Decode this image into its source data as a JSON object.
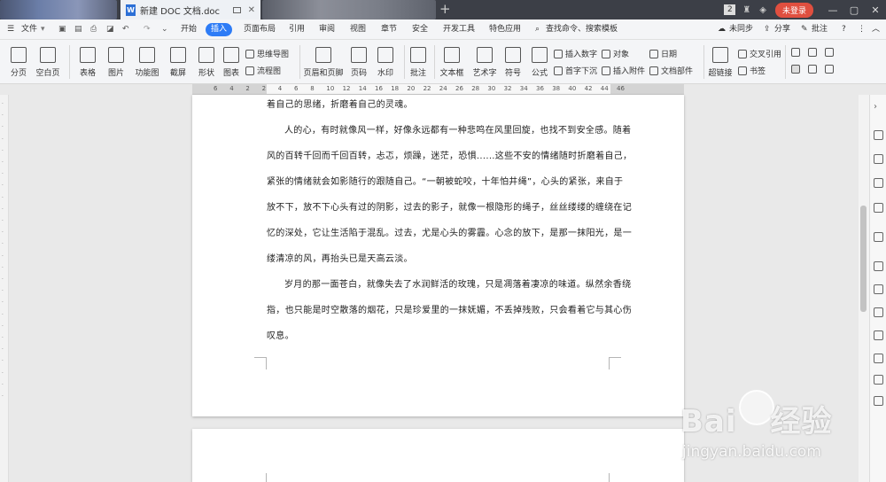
{
  "titlebar": {
    "tab_title": "新建 DOC 文档.doc",
    "badge_count": "2",
    "login_label": "未登录"
  },
  "menubar": {
    "file": "文件",
    "tabs": [
      "开始",
      "插入",
      "页面布局",
      "引用",
      "审阅",
      "视图",
      "章节",
      "安全",
      "开发工具",
      "特色应用"
    ],
    "search": "查找命令、搜索模板",
    "sync": "未同步",
    "share": "分享",
    "comment": "批注"
  },
  "ribbon": {
    "big": [
      "分页",
      "空白页",
      "表格",
      "图片",
      "功能图",
      "截屏",
      "形状",
      "图表",
      "页眉和页脚",
      "页码",
      "水印",
      "批注",
      "文本框",
      "艺术字",
      "符号",
      "公式",
      "超链接"
    ],
    "small": [
      "思维导图",
      "流程图",
      "插入数字",
      "对象",
      "日期",
      "首字下沉",
      "插入附件",
      "文档部件",
      "交叉引用",
      "书签"
    ]
  },
  "ruler": {
    "numbers": [
      "6",
      "4",
      "2",
      "2",
      "4",
      "6",
      "8",
      "10",
      "12",
      "14",
      "16",
      "18",
      "20",
      "22",
      "24",
      "26",
      "28",
      "30",
      "32",
      "34",
      "36",
      "38",
      "40",
      "42",
      "44",
      "46"
    ]
  },
  "document": {
    "lines": [
      "着自己的思绪，折磨着自己的灵魂。",
      "人的心，有时就像风一样，好像永远都有一种悲鸣在风里回旋，也找不到安全感。随着",
      "风的百转千回而千回百转，忐忑，烦躁，迷茫，恐惧......这些不安的情绪随时折磨着自己，",
      "紧张的情绪就会如影随行的跟随自己。“一朝被蛇咬，十年怕井绳”，心头的紧张，来自于",
      "放不下，放不下心头有过的阴影，过去的影子，就像一根隐形的绳子，丝丝缕缕的缠绕在记",
      "忆的深处，它让生活陷于混乱。过去，尤是心头的雾霾。心念的放下，是那一抹阳光，是一",
      "缕清凉的风，再抬头已是天高云淡。",
      "岁月的那一面苍白，就像失去了水润鲜活的玫瑰，只是凋落着凄凉的味道。纵然余香绕",
      "指，也只能是时空散落的烟花，只是珍爱里的一抹妩媚，不丢掉残败，只会看着它与其心伤",
      "叹息。"
    ]
  },
  "watermark": {
    "brand": "Bai",
    "brand_cn": "经验",
    "url": "jingyan.baidu.com"
  }
}
